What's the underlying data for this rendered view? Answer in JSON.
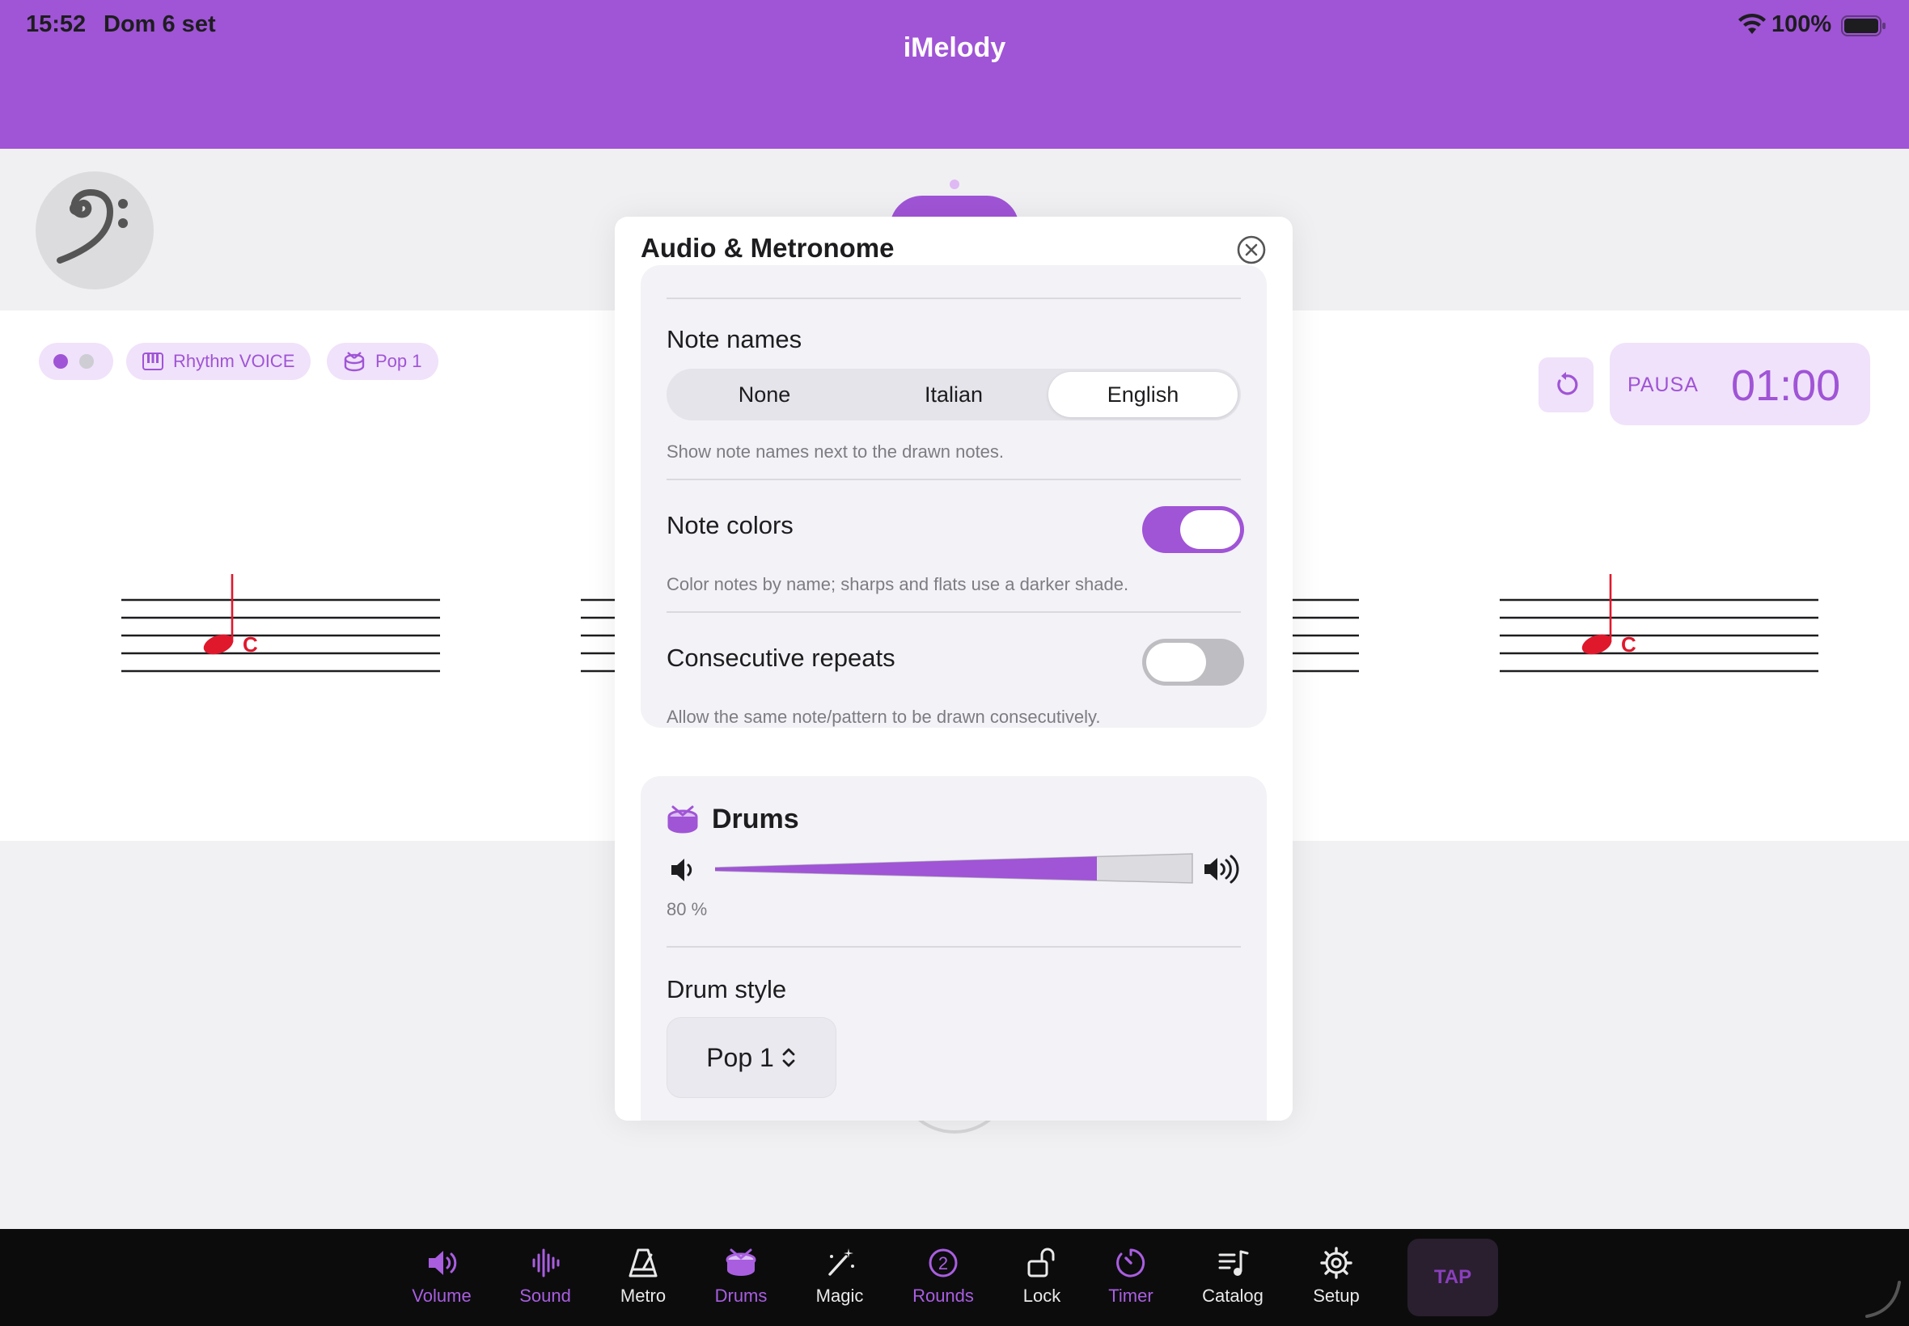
{
  "status_bar": {
    "time": "15:52",
    "date": "Dom 6 set",
    "battery": "100%"
  },
  "app": {
    "title": "iMelody"
  },
  "chips": {
    "instrument": "Rhythm VOICE",
    "drum_style": "Pop 1"
  },
  "timer": {
    "state": "PAUSA",
    "value": "01:00"
  },
  "score": {
    "note_label": "C"
  },
  "modal": {
    "title": "Audio & Metronome",
    "note_names": {
      "label": "Note names",
      "options": [
        "None",
        "Italian",
        "English"
      ],
      "selected": "English",
      "hint": "Show note names next to the drawn notes."
    },
    "note_colors": {
      "label": "Note colors",
      "enabled": true,
      "hint": "Color notes by name; sharps and flats use a darker shade."
    },
    "consecutive_repeats": {
      "label": "Consecutive repeats",
      "enabled": false,
      "hint": "Allow the same note/pattern to be drawn consecutively."
    },
    "drums": {
      "title": "Drums",
      "volume_fraction": 0.8,
      "volume_text": "80 %",
      "style_label": "Drum style",
      "style_value": "Pop 1"
    }
  },
  "tabs": [
    {
      "label": "Volume",
      "icon": "speaker-icon"
    },
    {
      "label": "Sound",
      "icon": "waveform-icon"
    },
    {
      "label": "Metro",
      "icon": "metronome-icon"
    },
    {
      "label": "Drums",
      "icon": "drum-icon"
    },
    {
      "label": "Magic",
      "icon": "magic-wand-icon"
    },
    {
      "label": "Rounds",
      "icon": "rounds-counter-icon",
      "badge": "2"
    },
    {
      "label": "Lock",
      "icon": "unlock-icon"
    },
    {
      "label": "Timer",
      "icon": "timer-icon"
    },
    {
      "label": "Catalog",
      "icon": "music-list-icon"
    },
    {
      "label": "Setup",
      "icon": "gear-icon"
    }
  ],
  "tap_button": "TAP",
  "colors": {
    "accent": "#a054d6",
    "accent_light": "#f0e2fa",
    "note_red": "#e0182c",
    "tab_bar": "#0c0c0d"
  }
}
